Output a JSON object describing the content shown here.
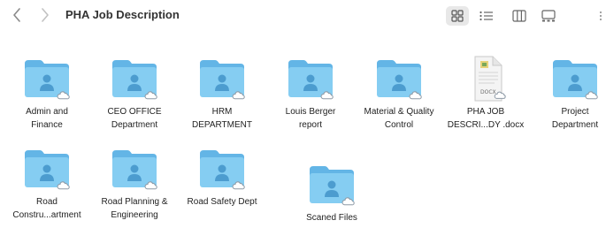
{
  "window": {
    "title": "PHA Job Description",
    "nav": {
      "back_icon": "chevron-left-icon",
      "forward_icon": "chevron-right-icon"
    },
    "view_modes": [
      "icon-view",
      "list-view",
      "column-view",
      "gallery-view"
    ],
    "selected_view": "icon-view"
  },
  "items": [
    {
      "label": "Admin and\nFinance",
      "type": "folder"
    },
    {
      "label": "CEO OFFICE\nDepartment",
      "type": "folder"
    },
    {
      "label": "HRM\nDEPARTMENT",
      "type": "folder"
    },
    {
      "label": "Louis  Berger\nreport",
      "type": "folder"
    },
    {
      "label": "Material & Quality\nControl",
      "type": "folder"
    },
    {
      "label": "PHA JOB\nDESCRI...DY .docx",
      "type": "docx"
    },
    {
      "label": "Project\nDepartment",
      "type": "folder"
    },
    {
      "label": "Road\nConstru...artment",
      "type": "folder"
    },
    {
      "label": "Road Planning &\nEngineering",
      "type": "folder"
    },
    {
      "label": "Road Safety Dept",
      "type": "folder"
    },
    {
      "label": "Scaned Files",
      "type": "folder"
    }
  ],
  "colors": {
    "folder_back": "#63b5e6",
    "folder_front": "#85cdf2",
    "person": "#4c9ccf",
    "cloud": "#ffffff",
    "cloud_stroke": "#8e9aa6"
  }
}
